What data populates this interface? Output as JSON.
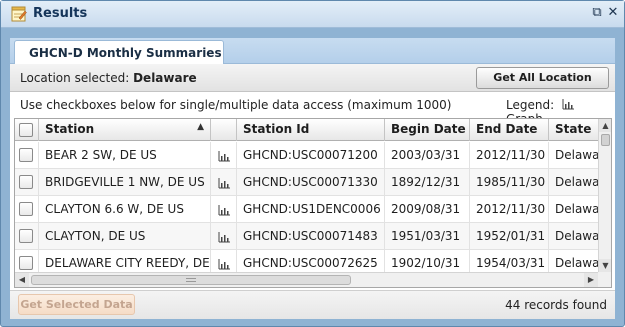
{
  "window": {
    "title": "Results",
    "icon": "notepad-icon",
    "restore_icon": "⧉",
    "close_icon": "✕"
  },
  "tab": {
    "label": "GHCN-D Monthly Summaries"
  },
  "location": {
    "label": "Location selected:",
    "value": "Delaware",
    "get_all_label": "Get All Location Data"
  },
  "hint": {
    "text": "Use checkboxes below for single/multiple data access (maximum 1000)",
    "legend_label": "Legend:",
    "legend_graph": "Graph"
  },
  "table": {
    "columns": [
      "Station",
      "Station Id",
      "Begin Date",
      "End Date",
      "State"
    ],
    "sort_indicator": "▲",
    "rows": [
      {
        "station": "BEAR 2 SW, DE US",
        "station_id": "GHCND:USC00071200",
        "begin": "2003/03/31",
        "end": "2012/11/30",
        "state": "Delaware"
      },
      {
        "station": "BRIDGEVILLE 1 NW, DE US",
        "station_id": "GHCND:USC00071330",
        "begin": "1892/12/31",
        "end": "1985/11/30",
        "state": "Delaware"
      },
      {
        "station": "CLAYTON 6.6 W, DE US",
        "station_id": "GHCND:US1DENC0006",
        "begin": "2009/08/31",
        "end": "2012/11/30",
        "state": "Delaware"
      },
      {
        "station": "CLAYTON, DE US",
        "station_id": "GHCND:USC00071483",
        "begin": "1951/03/31",
        "end": "1952/01/31",
        "state": "Delaware"
      },
      {
        "station": "DELAWARE CITY REEDY, DE US",
        "station_id": "GHCND:USC00072625",
        "begin": "1902/10/31",
        "end": "1954/03/31",
        "state": "Delaware"
      }
    ]
  },
  "footer": {
    "get_selected_label": "Get Selected Data",
    "records_text": "44 records found"
  },
  "colors": {
    "window_frame": "#8fb3d3",
    "tab_strip": "#b4cfea",
    "disabled_button": "#f6dcc6"
  }
}
